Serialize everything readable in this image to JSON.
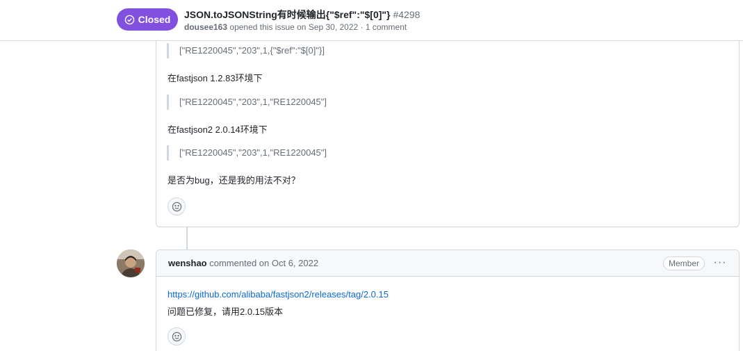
{
  "issue": {
    "state": "Closed",
    "title": "JSON.toJSONString有时候输出{\"$ref\":\"$[0]\"}",
    "number": "#4298",
    "author": "dousee163",
    "meta_text": "opened this issue on Sep 30, 2022 · 1 comment"
  },
  "first_comment": {
    "quote_1": "[\"RE1220045\",\"203\",1,{\"$ref\":\"$[0]\"}]",
    "para_1": "在fastjson 1.2.83环境下",
    "quote_2": "[\"RE1220045\",\"203\",1,\"RE1220045\"]",
    "para_2": "在fastjson2 2.0.14环境下",
    "quote_3": "[\"RE1220045\",\"203\",1,\"RE1220045\"]",
    "para_3": "是否为bug，还是我的用法不对？",
    "reaction_icon": "smiley-icon"
  },
  "second_comment": {
    "author": "wenshao",
    "action": "commented on Oct 6, 2022",
    "role_badge": "Member",
    "menu_icon": "···",
    "link": "https://github.com/alibaba/fastjson2/releases/tag/2.0.15",
    "text": "问题已修复，请用2.0.15版本",
    "reaction_icon": "smiley-icon"
  },
  "colors": {
    "closed_badge": "#8250df",
    "link": "#0969da",
    "border": "#d0d7de",
    "muted_text": "#656d76"
  }
}
